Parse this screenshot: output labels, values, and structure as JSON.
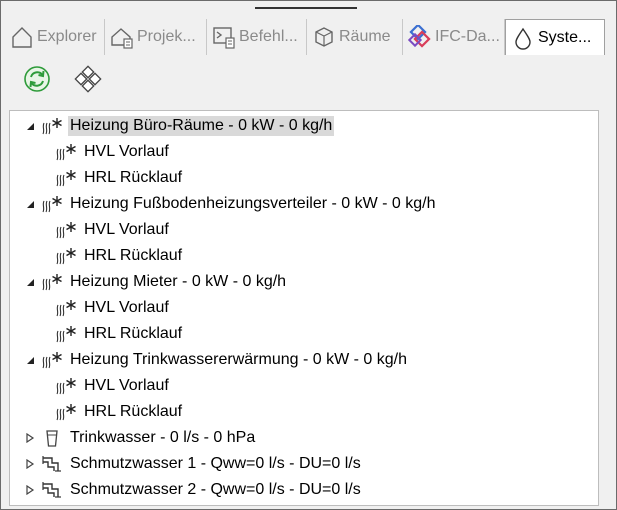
{
  "tabs": [
    {
      "label": "Explorer",
      "icon": "house-icon",
      "active": false
    },
    {
      "label": "Projek...",
      "icon": "project-house-icon",
      "active": false
    },
    {
      "label": "Befehl...",
      "icon": "command-console-icon",
      "active": false
    },
    {
      "label": "Räume",
      "icon": "room-cube-icon",
      "active": false
    },
    {
      "label": "IFC-Da...",
      "icon": "ifc-logo-icon",
      "active": false
    },
    {
      "label": "Syste...",
      "icon": "drop-icon",
      "active": true
    }
  ],
  "toolbar": {
    "refresh_icon": "refresh-icon",
    "layout_icon": "diamond-grid-icon"
  },
  "tree": [
    {
      "label": "Heizung Büro-Räume - 0 kW - 0 kg/h",
      "icon": "heating-icon",
      "level": 0,
      "expanded": true,
      "selected": true
    },
    {
      "label": "HVL Vorlauf",
      "icon": "heating-icon",
      "level": 1
    },
    {
      "label": "HRL Rücklauf",
      "icon": "heating-icon",
      "level": 1
    },
    {
      "label": "Heizung Fußbodenheizungsverteiler - 0 kW - 0 kg/h",
      "icon": "heating-icon",
      "level": 0,
      "expanded": true
    },
    {
      "label": "HVL Vorlauf",
      "icon": "heating-icon",
      "level": 1
    },
    {
      "label": "HRL Rücklauf",
      "icon": "heating-icon",
      "level": 1
    },
    {
      "label": "Heizung Mieter - 0 kW - 0 kg/h",
      "icon": "heating-icon",
      "level": 0,
      "expanded": true
    },
    {
      "label": "HVL Vorlauf",
      "icon": "heating-icon",
      "level": 1
    },
    {
      "label": "HRL Rücklauf",
      "icon": "heating-icon",
      "level": 1
    },
    {
      "label": "Heizung Trinkwassererwärmung - 0 kW - 0 kg/h",
      "icon": "heating-icon",
      "level": 0,
      "expanded": true
    },
    {
      "label": "HVL Vorlauf",
      "icon": "heating-icon",
      "level": 1
    },
    {
      "label": "HRL Rücklauf",
      "icon": "heating-icon",
      "level": 1
    },
    {
      "label": "Trinkwasser - 0 l/s - 0 hPa",
      "icon": "glass-icon",
      "level": 0,
      "expanded": false
    },
    {
      "label": "Schmutzwasser 1 -  Qww=0 l/s - DU=0 l/s",
      "icon": "wastewater-icon",
      "level": 0,
      "expanded": false
    },
    {
      "label": "Schmutzwasser 2 -  Qww=0 l/s - DU=0 l/s",
      "icon": "wastewater-icon",
      "level": 0,
      "expanded": false
    }
  ],
  "colors": {
    "selection": "#d9d9d9",
    "refresh_green": "#2e9b3a",
    "inactive_tab_text": "#8a8a8a"
  }
}
